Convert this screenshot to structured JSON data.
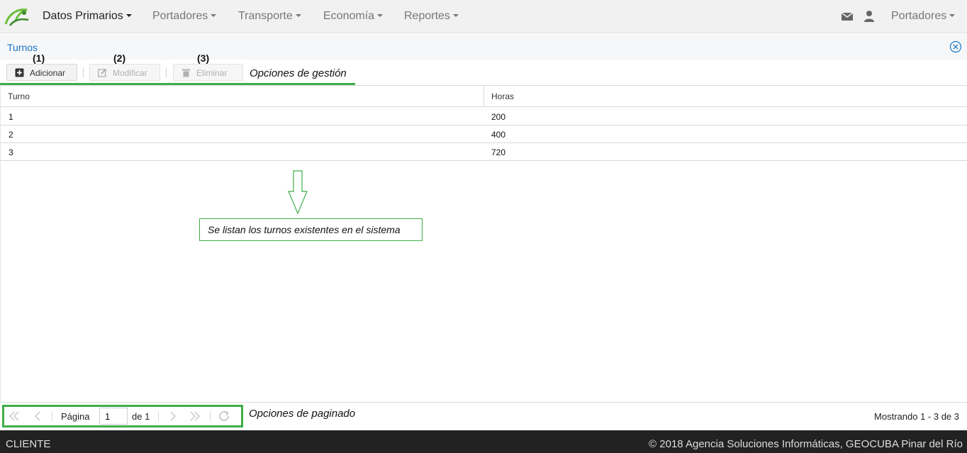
{
  "navbar": {
    "items": [
      {
        "label": "Datos Primarios"
      },
      {
        "label": "Portadores"
      },
      {
        "label": "Transporte"
      },
      {
        "label": "Economía"
      },
      {
        "label": "Reportes"
      }
    ],
    "user_menu_label": "Portadores",
    "icons": [
      "logo-icon",
      "mail-icon",
      "user-icon"
    ]
  },
  "panel": {
    "title": "Turnos"
  },
  "toolbar": {
    "markers": [
      "(1)",
      "(2)",
      "(3)"
    ],
    "add_label": "Adicionar",
    "edit_label": "Modificar",
    "delete_label": "Eliminar",
    "management_annotation": "Opciones de gestión"
  },
  "grid": {
    "columns": [
      "Turno",
      "Horas"
    ],
    "rows": [
      [
        "1",
        "200"
      ],
      [
        "2",
        "400"
      ],
      [
        "3",
        "720"
      ]
    ]
  },
  "callout": {
    "text": "Se listan los turnos existentes en el sistema",
    "accent_color": "#3fae49"
  },
  "pager": {
    "page_label": "Página",
    "page_value": "1",
    "of_label": "de 1",
    "annotation": "Opciones de paginado",
    "showing": "Mostrando 1 - 3 de 3"
  },
  "footer": {
    "left": "CLIENTE",
    "right": "© 2018 Agencia Soluciones Informáticas, GEOCUBA Pinar del Río"
  },
  "colors": {
    "link_blue": "#1a75c7",
    "annotation_green": "#3fae49",
    "footer_bg": "#222222"
  }
}
